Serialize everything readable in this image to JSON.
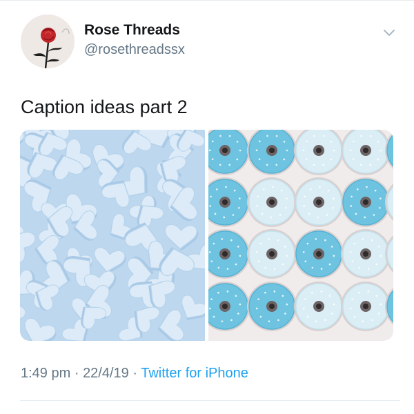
{
  "tweet": {
    "display_name": "Rose Threads",
    "handle": "@rosethreadssx",
    "text": "Caption ideas part 2",
    "time": "1:49 pm",
    "date": "22/4/19",
    "separator": "·",
    "source": "Twitter for iPhone"
  },
  "media": {
    "count": 2,
    "left_image": "light blue heart-shaped candies",
    "right_image": "light blue frosted sprinkled donuts"
  },
  "colors": {
    "name": "#14171a",
    "secondary": "#657786",
    "link": "#1da1f2",
    "candy": "#cfe2f3",
    "donut_blue": "#6ec4e0",
    "donut_pale": "#dbeef5"
  },
  "icons": {
    "caret": "chevron-down-icon",
    "avatar": "rose-avatar"
  }
}
